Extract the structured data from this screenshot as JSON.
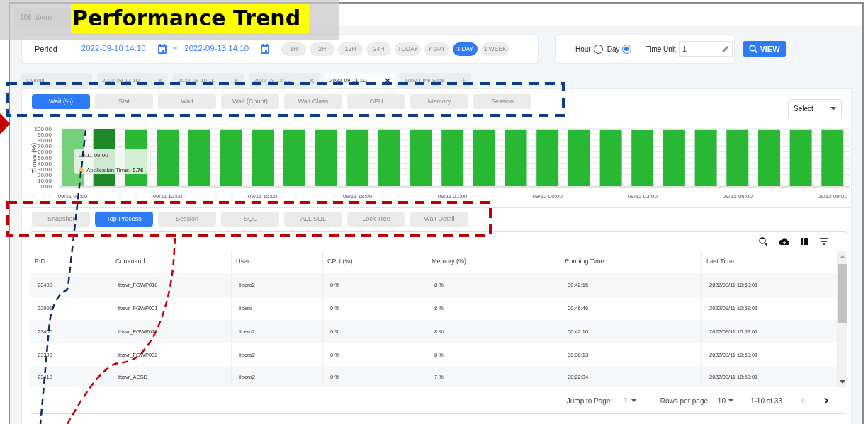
{
  "caption": "Performance Trend",
  "server_tab": {
    "label": "108-tibero"
  },
  "period": {
    "label": "Period",
    "start": "2022-09-10 14:10",
    "separator": "~",
    "end": "2022-09-13 14:10",
    "presets": [
      {
        "label": "1H",
        "selected": false
      },
      {
        "label": "2H",
        "selected": false
      },
      {
        "label": "12H",
        "selected": false
      },
      {
        "label": "24H",
        "selected": false
      },
      {
        "label": "TODAY",
        "selected": false
      },
      {
        "label": "Y DAY",
        "selected": false
      },
      {
        "label": "3 DAY",
        "selected": true
      },
      {
        "label": "1 WEEK",
        "selected": false
      }
    ]
  },
  "unit_options": [
    {
      "label": "Hour",
      "selected": false
    },
    {
      "label": "Day",
      "selected": true
    }
  ],
  "time_unit": {
    "label": "Time Unit",
    "value": "1"
  },
  "view_button": "VIEW",
  "time_slices": [
    {
      "label": "Overall",
      "selected": false,
      "kind": "plain"
    },
    {
      "label": "2022-09-13 1D",
      "selected": false,
      "kind": "closable"
    },
    {
      "label": "2022-09-10 1D",
      "selected": false,
      "kind": "closable"
    },
    {
      "label": "2022-09-12 1D",
      "selected": false,
      "kind": "closable"
    },
    {
      "label": "2022-09-11 1D",
      "selected": true,
      "kind": "closable"
    },
    {
      "label": "New Time Slice",
      "selected": false,
      "kind": "add"
    }
  ],
  "metric_tabs": [
    {
      "label": "Wait (%)",
      "selected": true
    },
    {
      "label": "Stat",
      "selected": false
    },
    {
      "label": "Wait",
      "selected": false
    },
    {
      "label": "Wait (Count)",
      "selected": false
    },
    {
      "label": "Wait Class",
      "selected": false
    },
    {
      "label": "CPU",
      "selected": false
    },
    {
      "label": "Memory",
      "selected": false
    },
    {
      "label": "Session",
      "selected": false
    }
  ],
  "select": {
    "placeholder": "Select"
  },
  "chart": {
    "chart_data": {
      "type": "bar",
      "grid": true,
      "ylabel": "Times (%)",
      "categories": [
        "09/11 09:00",
        null,
        null,
        "09/11 12:00",
        null,
        null,
        "09/11 15:00",
        null,
        null,
        "09/11 18:00",
        null,
        null,
        "09/11 21:00",
        null,
        null,
        "09/12 00:00",
        null,
        null,
        "09/12 03:00",
        null,
        null,
        "09/12 06:00",
        null,
        null,
        "09/12 09:00"
      ],
      "series": [
        {
          "color": "#28b834",
          "values": [
            100,
            100,
            99,
            99,
            99,
            99,
            99,
            99,
            99,
            99,
            99,
            99,
            99,
            99,
            99,
            99,
            99,
            99,
            98,
            99,
            99,
            99,
            99,
            99,
            99
          ]
        }
      ],
      "ylim": [
        0,
        100
      ],
      "yticks": [
        {
          "value": 0,
          "label": "0.00"
        },
        {
          "value": 10,
          "label": "10.00"
        },
        {
          "value": 20,
          "label": "20.00"
        },
        {
          "value": 30,
          "label": "30.00"
        },
        {
          "value": 40,
          "label": "40.00"
        },
        {
          "value": 50,
          "label": "50.00"
        },
        {
          "value": 60,
          "label": "60.00"
        },
        {
          "value": 70,
          "label": "70.00"
        },
        {
          "value": 80,
          "label": "80.00"
        },
        {
          "value": 90,
          "label": "90.00"
        },
        {
          "value": 100,
          "label": "100.00"
        }
      ]
    },
    "bars": [
      {
        "hovered": true,
        "selected": false
      },
      {
        "hovered": false,
        "selected": true
      },
      {
        "hovered": false,
        "selected": false
      },
      {
        "hovered": false,
        "selected": false
      },
      {
        "hovered": false,
        "selected": false
      },
      {
        "hovered": false,
        "selected": false
      },
      {
        "hovered": false,
        "selected": false
      },
      {
        "hovered": false,
        "selected": false
      },
      {
        "hovered": false,
        "selected": false
      },
      {
        "hovered": false,
        "selected": false
      },
      {
        "hovered": false,
        "selected": false
      },
      {
        "hovered": false,
        "selected": false
      },
      {
        "hovered": false,
        "selected": false
      },
      {
        "hovered": false,
        "selected": false
      },
      {
        "hovered": false,
        "selected": false
      },
      {
        "hovered": false,
        "selected": false
      },
      {
        "hovered": false,
        "selected": false
      },
      {
        "hovered": false,
        "selected": false
      },
      {
        "hovered": false,
        "selected": false
      },
      {
        "hovered": false,
        "selected": false
      },
      {
        "hovered": false,
        "selected": false
      },
      {
        "hovered": false,
        "selected": false
      },
      {
        "hovered": false,
        "selected": false
      },
      {
        "hovered": false,
        "selected": false
      },
      {
        "hovered": false,
        "selected": false
      }
    ],
    "tooltip": {
      "title": "09/11 09:00",
      "label": "Application Time:",
      "value": "0.76",
      "color": "#f5b85a"
    }
  },
  "detail_tabs": [
    {
      "label": "Snapshot",
      "selected": false
    },
    {
      "label": "Top Process",
      "selected": true
    },
    {
      "label": "Session",
      "selected": false
    },
    {
      "label": "SQL",
      "selected": false
    },
    {
      "label": "ALL SQL",
      "selected": false
    },
    {
      "label": "Lock Tree",
      "selected": false
    },
    {
      "label": "Wait Detail",
      "selected": false
    }
  ],
  "table": {
    "columns": [
      "PID",
      "Command",
      "User",
      "CPU (%)",
      "Memory (%)",
      "Running Time",
      "Last Time"
    ],
    "rows": [
      [
        "23409",
        "tbsvr_FGWP018",
        "tibero2",
        "0 %",
        "8 %",
        "00:42:15",
        "2022/09/11 10:59:01"
      ],
      [
        "22991",
        "tbsvr_FGWP001",
        "tibero",
        "0 %",
        "8 %",
        "00:46:46",
        "2022/09/11 10:59:01"
      ],
      [
        "23406",
        "tbsvr_FGWP018",
        "tibero2",
        "0 %",
        "8 %",
        "00:42:10",
        "2022/09/11 10:59:01"
      ],
      [
        "23393",
        "tbsvr_FGWP002",
        "tibero2",
        "0 %",
        "8 %",
        "00:38:13",
        "2022/09/11 10:59:01"
      ],
      [
        "23418",
        "tbsvr_ACSD",
        "tibero2",
        "0 %",
        "7 %",
        "00:22:34",
        "2022/09/11 10:59:01"
      ]
    ]
  },
  "pagination": {
    "jump_label": "Jump to Page:",
    "page": "1",
    "rows_label": "Rows per page:",
    "rows": "10",
    "range": "1-10 of 33"
  },
  "annotations": [
    {
      "kind": "frame",
      "color": "#0a3d8a"
    },
    {
      "kind": "frame",
      "color": "#c00000"
    },
    {
      "kind": "curve",
      "color": "#0a2d6a"
    },
    {
      "kind": "curve",
      "color": "#c00000"
    },
    {
      "kind": "pointer",
      "color": "#c00000"
    }
  ]
}
